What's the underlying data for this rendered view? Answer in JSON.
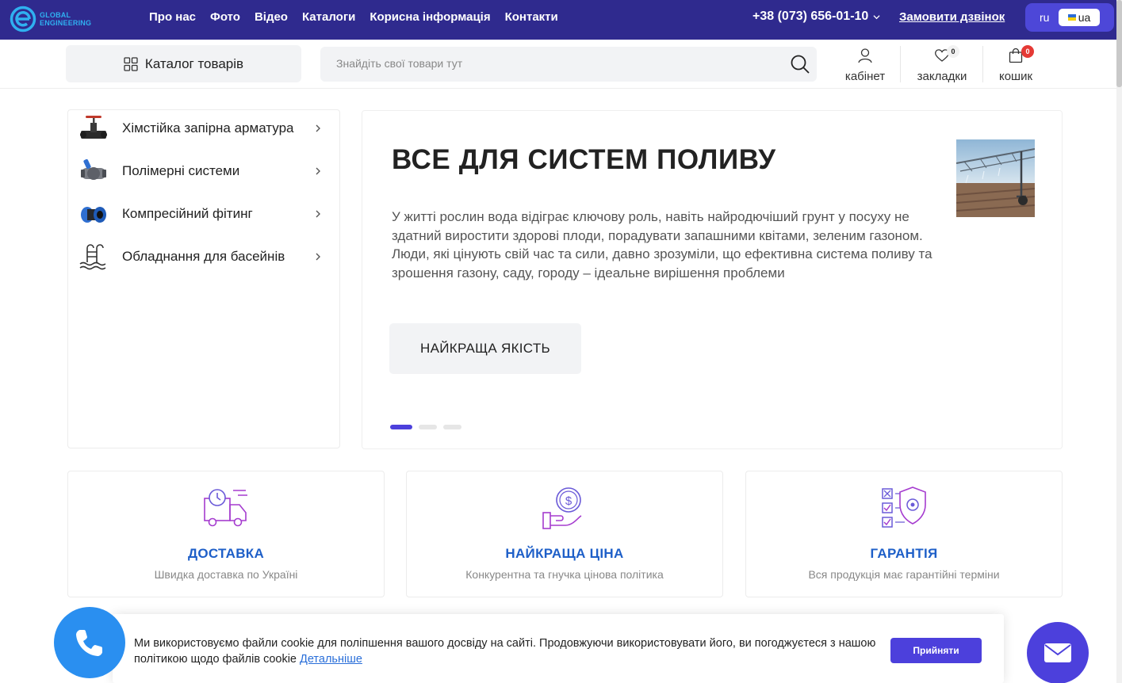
{
  "brand": {
    "logo_line1": "GLOBAL",
    "logo_line2": "ENGINEERING"
  },
  "topnav": [
    "Про нас",
    "Фото",
    "Відео",
    "Каталоги",
    "Корисна інформація",
    "Контакти"
  ],
  "phone": "+38 (073) 656-01-10",
  "callback_label": "Замовити дзвінок",
  "lang": {
    "ru": "ru",
    "ua": "ua"
  },
  "catalog_button": "Каталог товарів",
  "search": {
    "placeholder": "Знайдіть свої товари тут"
  },
  "header_actions": {
    "cabinet": "кабінет",
    "bookmarks": "закладки",
    "bookmarks_count": "0",
    "cart": "кошик",
    "cart_count": "0"
  },
  "categories": [
    {
      "label": "Хімстійка запірна арматура",
      "icon": "valve-icon"
    },
    {
      "label": "Полімерні системи",
      "icon": "ball-valve-icon"
    },
    {
      "label": "Компресійний фітинг",
      "icon": "fitting-icon"
    },
    {
      "label": "Обладнання для басейнів",
      "icon": "pool-ladder-icon"
    }
  ],
  "hero": {
    "title": "ВСЕ ДЛЯ СИСТЕМ ПОЛИВУ",
    "text": "У житті рослин вода відіграє ключову роль, навіть найродючіший грунт у посуху не здатний виростити здорові плоди, порадувати запашними квітами, зеленим газоном. Люди, які цінують свій час та сили, давно зрозуміли, що ефективна система поливу та зрошення газону, саду, городу – ідеальне вирішення проблеми",
    "button": "НАЙКРАЩА ЯКІСТЬ",
    "slides_total": 3,
    "slide_active": 1
  },
  "features": [
    {
      "title": "ДОСТАВКА",
      "subtitle": "Швидка доставка по Україні",
      "icon": "delivery-truck-icon"
    },
    {
      "title": "НАЙКРАЩА ЦІНА",
      "subtitle": "Конкурентна та гнучка цінова політика",
      "icon": "price-hand-icon"
    },
    {
      "title": "ГАРАНТІЯ",
      "subtitle": "Вся продукція має гарантійні терміни",
      "icon": "guarantee-shield-icon"
    }
  ],
  "cookie": {
    "text": "Ми використовуємо файли cookie для поліпшення вашого досвіду на сайті. Продовжуючи використовувати його, ви погоджуєтеся з нашою політикою щодо файлів cookie",
    "link": "Детальніше",
    "accept": "Прийняти"
  },
  "colors": {
    "topbar": "#2f2a8e",
    "accent": "#4c40dc",
    "feature_title": "#1e5fc8",
    "phone_float": "#2a8ff0",
    "badge": "#e53935"
  }
}
